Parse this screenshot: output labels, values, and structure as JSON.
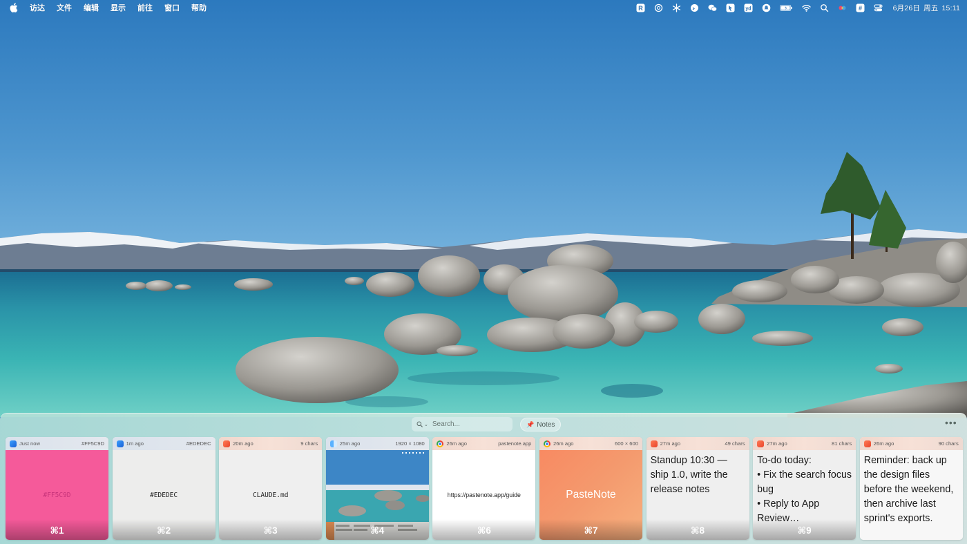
{
  "menubar": {
    "apple": "",
    "menus": [
      "访达",
      "文件",
      "编辑",
      "显示",
      "前往",
      "窗口",
      "帮助"
    ],
    "status_icons": [
      "r-app-icon",
      "openai-icon",
      "snowflake-icon",
      "chat-bubble-icon",
      "wechat-icon",
      "arrow-app-icon",
      "yd-app-icon",
      "bell-icon",
      "battery-icon",
      "wifi-icon",
      "search-icon",
      "colorful-dots-icon",
      "hash-icon",
      "control-center-icon"
    ],
    "yd_label": "yd",
    "r_label": "R",
    "hash_label": "#",
    "date": "6月26日",
    "weekday": "周五",
    "time": "15:11"
  },
  "panel": {
    "search_placeholder": "Search...",
    "notes_label": "Notes",
    "more_label": "•••",
    "cards": [
      {
        "time": "Just now",
        "info": "#FF5C9D",
        "content": "#FF5C9D",
        "shortcut": "⌘1",
        "app": "blue",
        "color": "#F55A9A"
      },
      {
        "time": "1m ago",
        "info": "#EDEDEC",
        "content": "#EDEDEC",
        "shortcut": "⌘2",
        "app": "blue",
        "color": "#EDEDEC"
      },
      {
        "time": "20m ago",
        "info": "9 chars",
        "content": "CLAUDE.md",
        "shortcut": "⌘3",
        "app": "red"
      },
      {
        "time": "25m ago",
        "info": "1920 × 1080",
        "content": "",
        "shortcut": "⌘4",
        "app": "finder"
      },
      {
        "time": "26m ago",
        "info": "pastenote.app",
        "content": "https://pastenote.app/guide",
        "shortcut": "⌘6",
        "app": "chrome"
      },
      {
        "time": "26m ago",
        "info": "600 × 600",
        "content": "PasteNote",
        "shortcut": "⌘7",
        "app": "chrome"
      },
      {
        "time": "27m ago",
        "info": "49 chars",
        "content": "Standup 10:30 — ship 1.0, write the release notes",
        "shortcut": "⌘8",
        "app": "red"
      },
      {
        "time": "27m ago",
        "info": "81 chars",
        "lines": [
          "To-do today:",
          "• Fix the search focus bug",
          "• Reply to App Review…"
        ],
        "shortcut": "⌘9",
        "app": "red"
      },
      {
        "time": "26m ago",
        "info": "90 chars",
        "content": "Reminder: back up the design files before the weekend, then archive last sprint's exports.",
        "shortcut": "",
        "app": "red"
      }
    ]
  }
}
